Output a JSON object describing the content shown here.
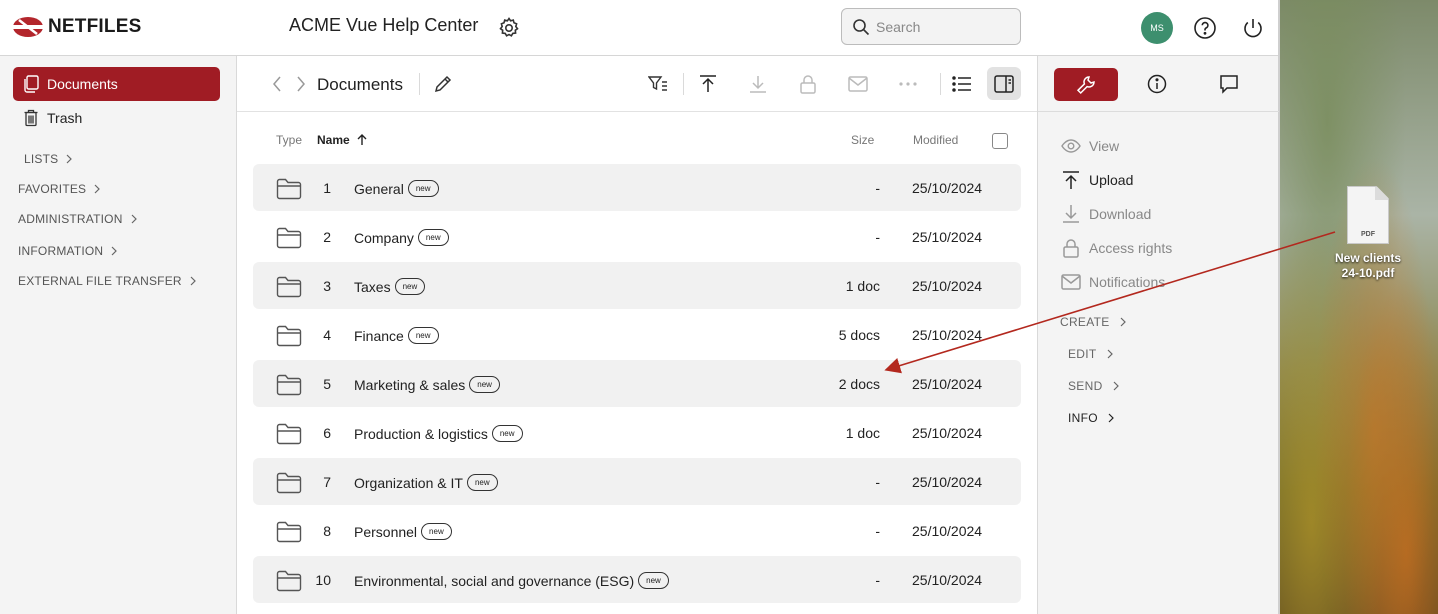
{
  "header": {
    "logo_text": "NETFILES",
    "app_title": "ACME Vue Help Center",
    "search_placeholder": "Search",
    "avatar_initials": "MS"
  },
  "sidebar": {
    "items": [
      {
        "label": "Documents",
        "icon": "documents-icon",
        "active": true
      },
      {
        "label": "Trash",
        "icon": "trash-icon",
        "active": false
      }
    ],
    "sections": [
      "LISTS",
      "FAVORITES",
      "ADMINISTRATION",
      "INFORMATION",
      "EXTERNAL FILE TRANSFER"
    ]
  },
  "toolbar": {
    "breadcrumb_title": "Documents"
  },
  "table": {
    "columns": {
      "type": "Type",
      "name": "Name",
      "size": "Size",
      "modified": "Modified"
    },
    "rows": [
      {
        "num": "1",
        "name": "General",
        "badge": "new",
        "size": "-",
        "modified": "25/10/2024"
      },
      {
        "num": "2",
        "name": "Company",
        "badge": "new",
        "size": "-",
        "modified": "25/10/2024"
      },
      {
        "num": "3",
        "name": "Taxes",
        "badge": "new",
        "size": "1 doc",
        "modified": "25/10/2024"
      },
      {
        "num": "4",
        "name": "Finance",
        "badge": "new",
        "size": "5 docs",
        "modified": "25/10/2024"
      },
      {
        "num": "5",
        "name": "Marketing & sales",
        "badge": "new",
        "size": "2 docs",
        "modified": "25/10/2024"
      },
      {
        "num": "6",
        "name": "Production & logistics",
        "badge": "new",
        "size": "1 doc",
        "modified": "25/10/2024"
      },
      {
        "num": "7",
        "name": "Organization & IT",
        "badge": "new",
        "size": "-",
        "modified": "25/10/2024"
      },
      {
        "num": "8",
        "name": "Personnel",
        "badge": "new",
        "size": "-",
        "modified": "25/10/2024"
      },
      {
        "num": "10",
        "name": "Environmental, social and governance (ESG)",
        "badge": "new",
        "size": "-",
        "modified": "25/10/2024"
      }
    ]
  },
  "right_panel": {
    "actions": [
      {
        "label": "View",
        "icon": "eye-icon",
        "enabled": false
      },
      {
        "label": "Upload",
        "icon": "upload-icon",
        "enabled": true
      },
      {
        "label": "Download",
        "icon": "download-icon",
        "enabled": false
      },
      {
        "label": "Access rights",
        "icon": "lock-icon",
        "enabled": false
      },
      {
        "label": "Notifications",
        "icon": "mail-icon",
        "enabled": false
      }
    ],
    "groups": [
      {
        "label": "CREATE",
        "active": false
      },
      {
        "label": "EDIT",
        "active": false
      },
      {
        "label": "SEND",
        "active": false
      },
      {
        "label": "INFO",
        "active": true
      }
    ]
  },
  "desktop_file": {
    "type_label": "PDF",
    "name_line1": "New clients",
    "name_line2": "24-10.pdf"
  },
  "colors": {
    "accent": "#a01c24",
    "avatar": "#3d8f6e",
    "drag_arrow": "#b3281e"
  }
}
